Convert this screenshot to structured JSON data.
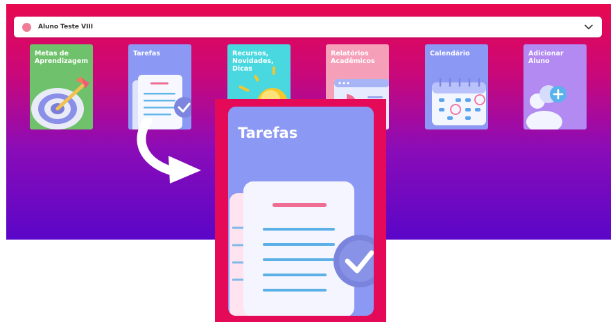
{
  "student_selector": {
    "name": "Aluno Teste VIII",
    "dot_color": "#f07d97"
  },
  "cards": [
    {
      "label": "Metas de\nAprendizagem",
      "icon": "target-arrow-icon",
      "color": "#6fc26b"
    },
    {
      "label": "Tarefas",
      "icon": "document-checkmark-icon",
      "color": "#8b99f4"
    },
    {
      "label": "Recursos,\nNovidades,\nDicas",
      "icon": "lightbulb-sun-icon",
      "color": "#4ad8e0"
    },
    {
      "label": "Relatórios\nAcadêmicos",
      "icon": "report-chart-icon",
      "color": "#f5a0b8"
    },
    {
      "label": "Calendário",
      "icon": "calendar-icon",
      "color": "#8b99f4"
    },
    {
      "label": "Adicionar\nAluno",
      "icon": "add-user-icon",
      "color": "#b28af2"
    }
  ],
  "zoom": {
    "label": "Tarefas",
    "icon": "document-checkmark-icon"
  }
}
